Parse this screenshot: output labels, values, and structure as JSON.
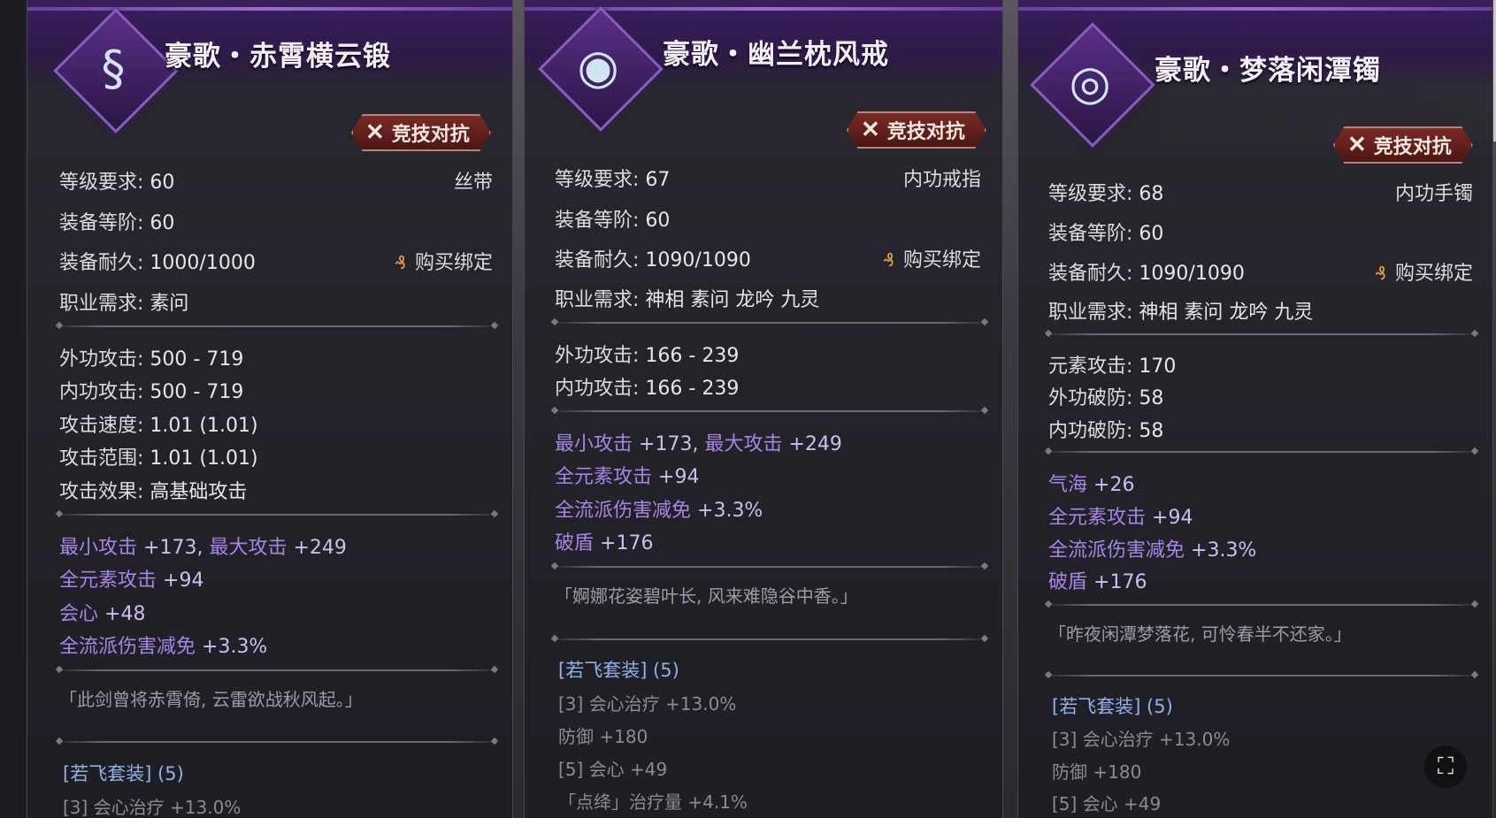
{
  "cards": [
    {
      "title": "豪歌・赤霄横云锻",
      "badge": "竞技对抗",
      "icon": "ribbon-icon",
      "level_label": "等级要求:",
      "level": "60",
      "type": "丝带",
      "tier_label": "装备等阶:",
      "tier": "60",
      "durability_label": "装备耐久:",
      "durability": "1000/1000",
      "bind": "购买绑定",
      "class_label": "职业需求:",
      "classes": "素问",
      "base_stats": [
        {
          "label": "外功攻击:",
          "value": "500  -  719"
        },
        {
          "label": "内功攻击:",
          "value": "500  -  719"
        },
        {
          "label": "攻击速度:",
          "value": "1.01 (1.01)"
        },
        {
          "label": "攻击范围:",
          "value": "1.01 (1.01)"
        },
        {
          "label": "攻击效果:",
          "value": "高基础攻击"
        }
      ],
      "bonus_stats": [
        {
          "label": "最小攻击",
          "value": "+173, ",
          "label2": "最大攻击",
          "value2": "+249"
        },
        {
          "label": "全元素攻击",
          "value": "+94"
        },
        {
          "label": "会心",
          "value": "+48"
        },
        {
          "label": "全流派伤害减免",
          "value": "+3.3%"
        }
      ],
      "quote": "「此剑曾将赤霄倚, 云雷欲战秋风起。」",
      "set_title": "[若飞套装] (5)",
      "set_bonuses": [
        "[3] 会心治疗  +13.0%"
      ]
    },
    {
      "title": "豪歌・幽兰枕风戒",
      "badge": "竞技对抗",
      "icon": "ring-icon",
      "level_label": "等级要求:",
      "level": "67",
      "type": "内功戒指",
      "tier_label": "装备等阶:",
      "tier": "60",
      "durability_label": "装备耐久:",
      "durability": "1090/1090",
      "bind": "购买绑定",
      "class_label": "职业需求:",
      "classes": "神相  素问  龙吟  九灵",
      "base_stats": [
        {
          "label": "外功攻击:",
          "value": "166  -  239"
        },
        {
          "label": "内功攻击:",
          "value": "166  -  239"
        }
      ],
      "bonus_stats": [
        {
          "label": "最小攻击",
          "value": "+173, ",
          "label2": "最大攻击",
          "value2": "+249"
        },
        {
          "label": "全元素攻击",
          "value": "+94"
        },
        {
          "label": "全流派伤害减免",
          "value": "+3.3%"
        },
        {
          "label": "破盾",
          "value": "+176"
        }
      ],
      "quote": "「婀娜花姿碧叶长, 风来难隐谷中香。」",
      "set_title": "[若飞套装] (5)",
      "set_bonuses": [
        "[3] 会心治疗  +13.0%",
        "防御  +180",
        "[5] 会心  +49",
        "「点绛」治疗量  +4.1%"
      ]
    },
    {
      "title": "豪歌・梦落闲潭镯",
      "badge": "竞技对抗",
      "icon": "bracelet-icon",
      "level_label": "等级要求:",
      "level": "68",
      "type": "内功手镯",
      "tier_label": "装备等阶:",
      "tier": "60",
      "durability_label": "装备耐久:",
      "durability": "1090/1090",
      "bind": "购买绑定",
      "class_label": "职业需求:",
      "classes": "神相  素问  龙吟  九灵",
      "base_stats": [
        {
          "label": "元素攻击:",
          "value": "170"
        },
        {
          "label": "外功破防:",
          "value": "58"
        },
        {
          "label": "内功破防:",
          "value": "58"
        }
      ],
      "bonus_stats": [
        {
          "label": "气海",
          "value": "+26"
        },
        {
          "label": "全元素攻击",
          "value": "+94"
        },
        {
          "label": "全流派伤害减免",
          "value": "+3.3%"
        },
        {
          "label": "破盾",
          "value": "+176"
        }
      ],
      "quote": "「昨夜闲潭梦落花, 可怜春半不还家。」",
      "set_title": "[若飞套装] (5)",
      "set_bonuses": [
        "[3] 会心治疗  +13.0%",
        "防御  +180",
        "[5] 会心  +49"
      ]
    }
  ],
  "fullscreen_icon": "⛶"
}
